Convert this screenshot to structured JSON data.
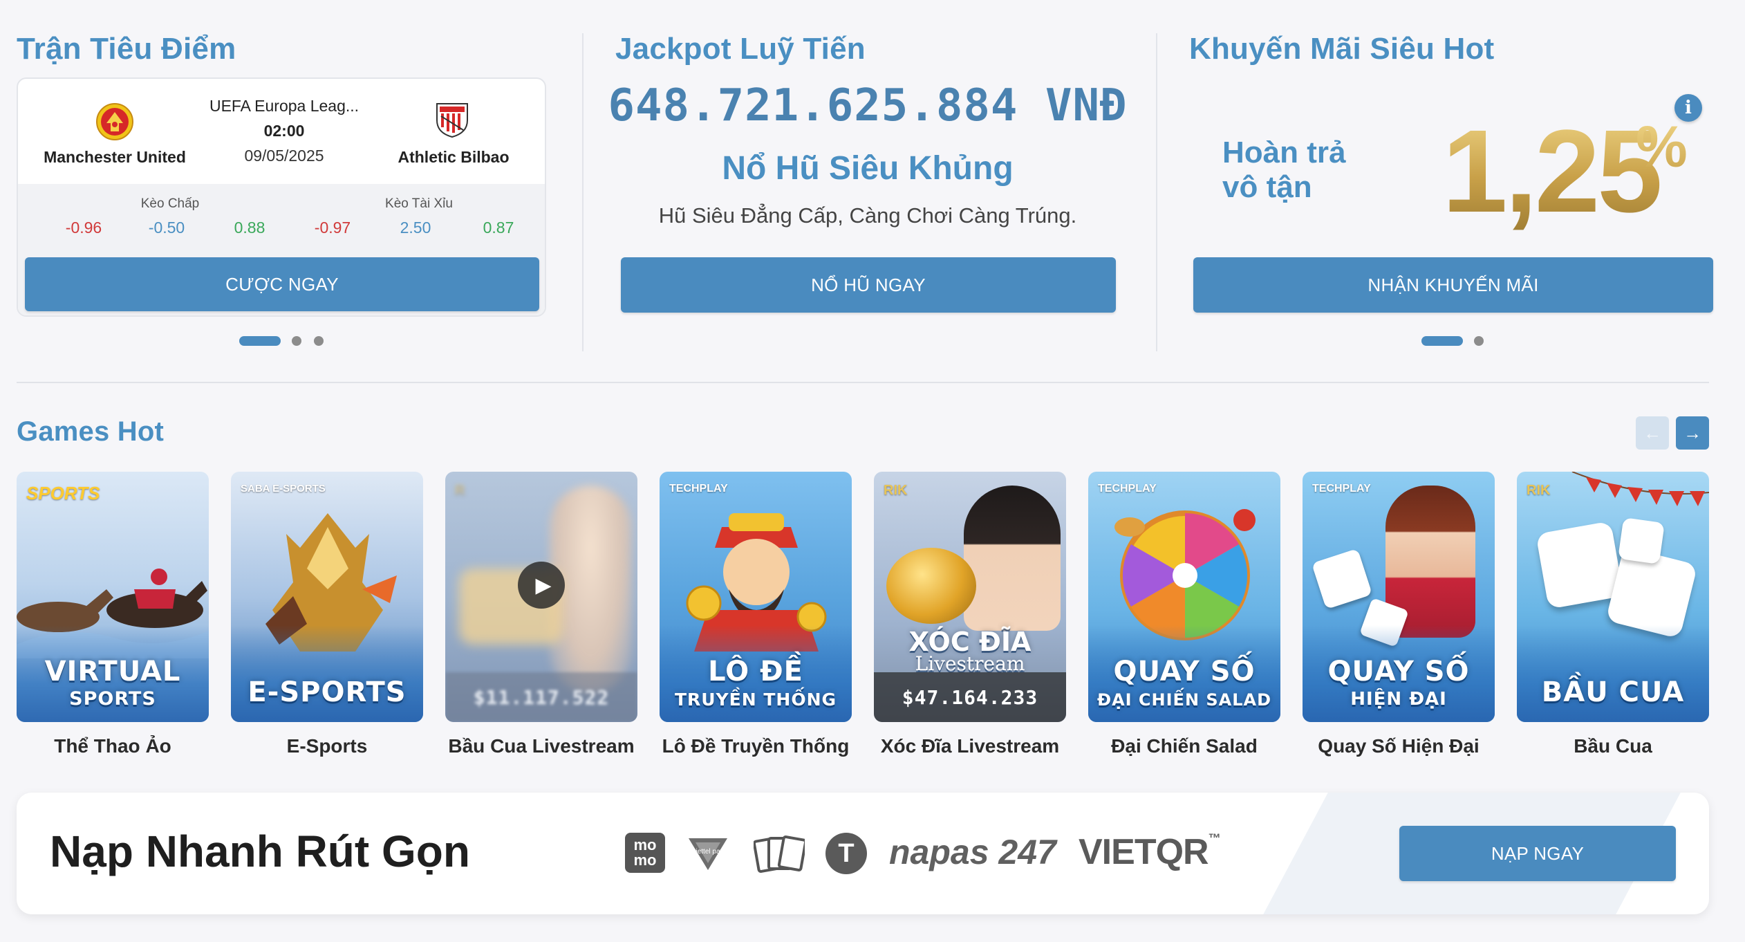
{
  "featured": {
    "title": "Trận Tiêu Điểm",
    "league": "UEFA Europa Leag...",
    "time": "02:00",
    "date": "09/05/2025",
    "home_team": "Manchester United",
    "away_team": "Athletic Bilbao",
    "handicap_label": "Kèo Chấp",
    "overunder_label": "Kèo Tài Xỉu",
    "handicap_odds": [
      "-0.96",
      "-0.50",
      "0.88"
    ],
    "overunder_odds": [
      "-0.97",
      "2.50",
      "0.87"
    ],
    "bet_button": "CƯỢC NGAY"
  },
  "jackpot": {
    "title": "Jackpot Luỹ Tiến",
    "amount": "648.721.625.884 VNĐ",
    "headline": "Nổ Hũ Siêu Khủng",
    "subtitle": "Hũ Siêu Đẳng Cấp, Càng Chơi Càng Trúng.",
    "button": "NỔ HŨ NGAY"
  },
  "promo": {
    "title": "Khuyến Mãi Siêu Hot",
    "line1": "Hoàn trả",
    "line2": "vô tận",
    "rate": "1,25",
    "percent": "%",
    "info": "i",
    "button": "NHẬN KHUYẾN MÃI"
  },
  "games_hot": {
    "title": "Games Hot",
    "prev_arrow": "←",
    "next_arrow": "→",
    "games": [
      {
        "label": "Thể Thao Ảo",
        "provider": "SPORTS",
        "art_main": "VIRTUAL",
        "art_sub": "SPORTS"
      },
      {
        "label": "E-Sports",
        "provider": "SABA E-SPORTS",
        "art_main": "E-SPORTS"
      },
      {
        "label": "Bầu Cua Livestream",
        "provider": "R",
        "jackpot": "$11.117.522"
      },
      {
        "label": "Lô Đề Truyền Thống",
        "provider": "TECHPLAY",
        "art_main": "LÔ ĐỀ",
        "art_sub": "TRUYỀN THỐNG"
      },
      {
        "label": "Xóc Đĩa Livestream",
        "provider": "RIK",
        "art_main": "XÓC ĐĨA",
        "art_sub": "Livestream",
        "jackpot": "$47.164.233"
      },
      {
        "label": "Đại Chiến Salad",
        "provider": "TECHPLAY",
        "art_main": "QUAY SỐ",
        "art_sub": "ĐẠI CHIẾN SALAD"
      },
      {
        "label": "Quay Số Hiện Đại",
        "provider": "TECHPLAY",
        "art_main": "QUAY SỐ",
        "art_sub": "HIỆN ĐẠI"
      },
      {
        "label": "Bầu Cua",
        "provider": "RIK",
        "art_main": "BẦU CUA"
      }
    ]
  },
  "deposit": {
    "title": "Nạp Nhanh Rút Gọn",
    "momo_top": "mo",
    "momo_bottom": "mo",
    "viettel": "viettel pay",
    "card": "card",
    "tether": "T",
    "napas": "napas 247",
    "vietqr": "VIETQR",
    "vietqr_tm": "™",
    "button": "NẠP NGAY"
  },
  "colors": {
    "accent": "#4a8bbf",
    "title_blue": "#4a8fc2",
    "gold": "#c9a64a",
    "negative": "#d13a3a",
    "positive": "#3aa85a"
  }
}
